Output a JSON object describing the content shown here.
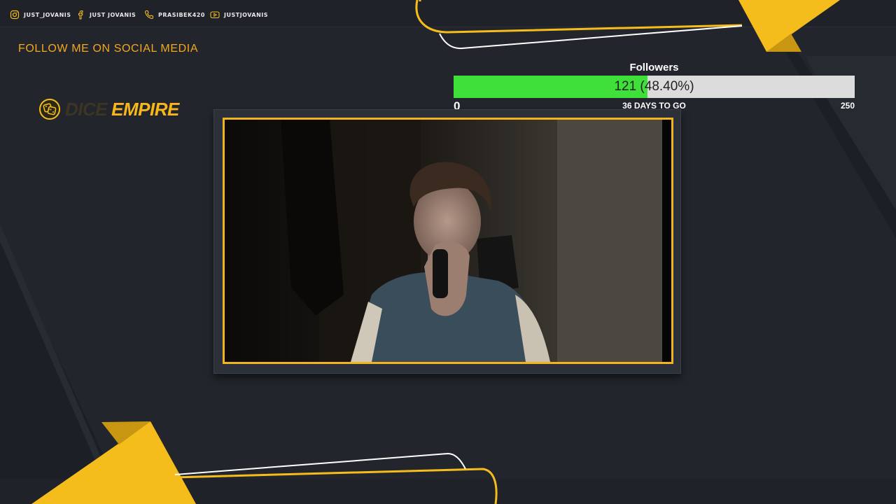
{
  "socials": [
    {
      "icon": "instagram-icon",
      "label": "JUST_JOVANIS"
    },
    {
      "icon": "facebook-icon",
      "label": "JUST JOVANIS"
    },
    {
      "icon": "phone-icon",
      "label": "PRASIBEK420"
    },
    {
      "icon": "youtube-icon",
      "label": "JUSTJOVANIS"
    }
  ],
  "follow_text": "FOLLOW ME ON SOCIAL MEDIA",
  "logo": {
    "dim_text": "DICE",
    "main_text": "EMPIRE",
    "icon": "dice-icon"
  },
  "goal": {
    "title": "Followers",
    "current": 121,
    "target": 250,
    "fraction": 0.484,
    "progress_text": "121 (48.40%)",
    "min_label": "0",
    "days_left": "36 DAYS TO GO",
    "max_label": "250"
  },
  "webcam": {
    "description_name": "webcam-feed"
  },
  "colors": {
    "background": "#22252c",
    "accent": "#f7b61a",
    "progress_fill": "#3fe03a",
    "progress_track": "#dcdcdc"
  }
}
